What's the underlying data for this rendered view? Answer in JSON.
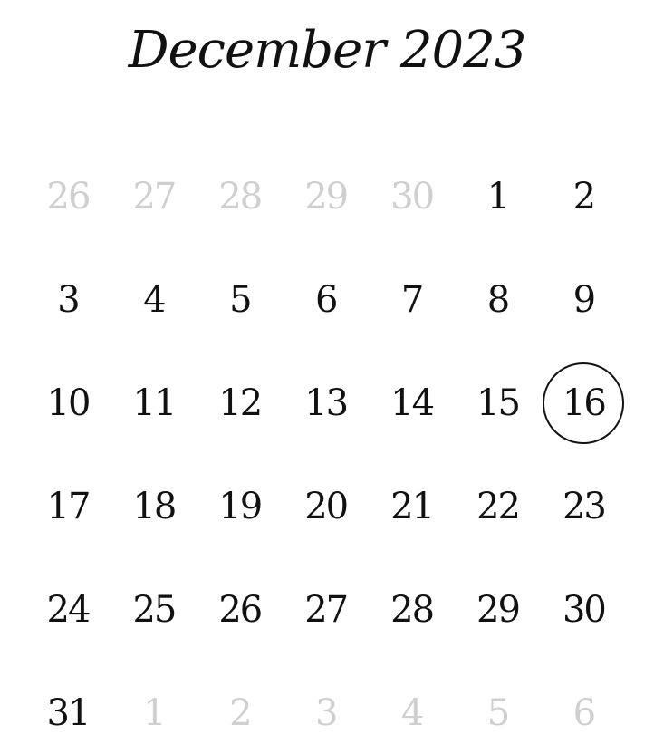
{
  "calendar": {
    "title": "December 2023",
    "today": 16,
    "colors": {
      "text": "#111111",
      "muted": "#cfcfcf",
      "ring": "#111111"
    },
    "weeks": [
      [
        {
          "day": "26",
          "muted": true
        },
        {
          "day": "27",
          "muted": true
        },
        {
          "day": "28",
          "muted": true
        },
        {
          "day": "29",
          "muted": true
        },
        {
          "day": "30",
          "muted": true
        },
        {
          "day": "1",
          "muted": false
        },
        {
          "day": "2",
          "muted": false
        }
      ],
      [
        {
          "day": "3",
          "muted": false
        },
        {
          "day": "4",
          "muted": false
        },
        {
          "day": "5",
          "muted": false
        },
        {
          "day": "6",
          "muted": false
        },
        {
          "day": "7",
          "muted": false
        },
        {
          "day": "8",
          "muted": false
        },
        {
          "day": "9",
          "muted": false
        }
      ],
      [
        {
          "day": "10",
          "muted": false
        },
        {
          "day": "11",
          "muted": false
        },
        {
          "day": "12",
          "muted": false
        },
        {
          "day": "13",
          "muted": false
        },
        {
          "day": "14",
          "muted": false
        },
        {
          "day": "15",
          "muted": false
        },
        {
          "day": "16",
          "muted": false,
          "selected": true
        }
      ],
      [
        {
          "day": "17",
          "muted": false
        },
        {
          "day": "18",
          "muted": false
        },
        {
          "day": "19",
          "muted": false
        },
        {
          "day": "20",
          "muted": false
        },
        {
          "day": "21",
          "muted": false
        },
        {
          "day": "22",
          "muted": false
        },
        {
          "day": "23",
          "muted": false
        }
      ],
      [
        {
          "day": "24",
          "muted": false
        },
        {
          "day": "25",
          "muted": false
        },
        {
          "day": "26",
          "muted": false
        },
        {
          "day": "27",
          "muted": false
        },
        {
          "day": "28",
          "muted": false
        },
        {
          "day": "29",
          "muted": false
        },
        {
          "day": "30",
          "muted": false
        }
      ],
      [
        {
          "day": "31",
          "muted": false
        },
        {
          "day": "1",
          "muted": true
        },
        {
          "day": "2",
          "muted": true
        },
        {
          "day": "3",
          "muted": true
        },
        {
          "day": "4",
          "muted": true
        },
        {
          "day": "5",
          "muted": true
        },
        {
          "day": "6",
          "muted": true
        }
      ]
    ]
  }
}
